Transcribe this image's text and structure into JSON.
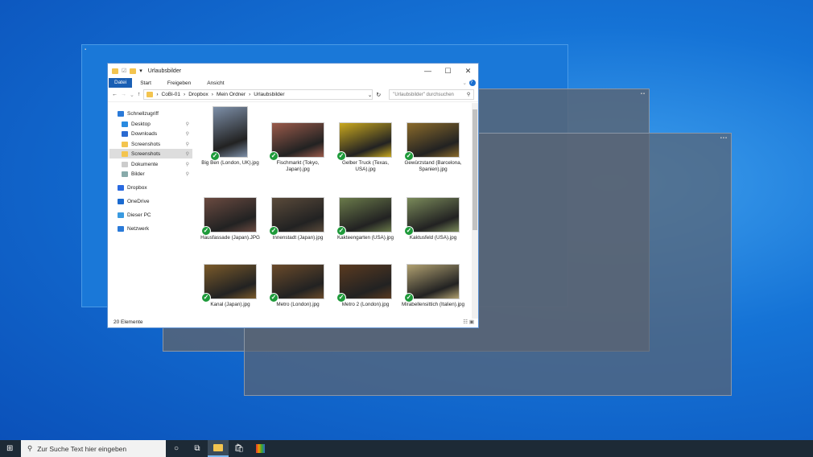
{
  "explorer": {
    "title": "Urlaubsbilder",
    "ribbon_tabs": [
      "Datei",
      "Start",
      "Freigeben",
      "Ansicht"
    ],
    "breadcrumb": [
      "CoBi-01",
      "Dropbox",
      "Mein Ordner",
      "Urlaubsbilder"
    ],
    "search_placeholder": "\"Urlaubsbilder\" durchsuchen",
    "sidebar": [
      {
        "label": "Schnellzugriff",
        "icon": "star-icon"
      },
      {
        "label": "Desktop",
        "icon": "desktop-icon",
        "pinned": true
      },
      {
        "label": "Downloads",
        "icon": "download-icon",
        "pinned": true
      },
      {
        "label": "Screenshots",
        "icon": "folder-icon",
        "pinned": true
      },
      {
        "label": "Screenshots",
        "icon": "folder-sync-icon",
        "pinned": true,
        "selected": true
      },
      {
        "label": "Dokumente",
        "icon": "document-icon",
        "pinned": true
      },
      {
        "label": "Bilder",
        "icon": "pictures-icon",
        "pinned": true
      },
      {
        "label": "Dropbox",
        "icon": "dropbox-icon"
      },
      {
        "label": "OneDrive",
        "icon": "cloud-icon"
      },
      {
        "label": "Dieser PC",
        "icon": "pc-icon"
      },
      {
        "label": "Netzwerk",
        "icon": "network-icon"
      }
    ],
    "files": [
      {
        "name": "Big Ben (London, UK).jpg",
        "color": "#7d8fa8"
      },
      {
        "name": "Fischmarkt (Tokyo, Japan).jpg",
        "color": "#9a5a4a"
      },
      {
        "name": "Gelber Truck (Texas, USA).jpg",
        "color": "#c9a81e"
      },
      {
        "name": "Gewürzstand (Barcelona, Spanien).jpg",
        "color": "#8a6a2a"
      },
      {
        "name": "Hausfassade (Japan).JPG",
        "color": "#6a4a40"
      },
      {
        "name": "Innenstadt (Japan).jpg",
        "color": "#5a4a3a"
      },
      {
        "name": "Kakteengarten (USA).jpg",
        "color": "#6a7a4a"
      },
      {
        "name": "Kaktusfeld (USA).jpg",
        "color": "#7a8a5a"
      },
      {
        "name": "Kanal (Japan).jpg",
        "color": "#7a5a2a"
      },
      {
        "name": "Metro (London).jpg",
        "color": "#6a4a2a"
      },
      {
        "name": "Metro 2 (London).jpg",
        "color": "#5a3a20"
      },
      {
        "name": "Mirabellensittich (Italien).jpg",
        "color": "#b0a070"
      }
    ],
    "status": "20 Elemente"
  },
  "taskbar": {
    "search_placeholder": "Zur Suche Text hier eingeben"
  }
}
